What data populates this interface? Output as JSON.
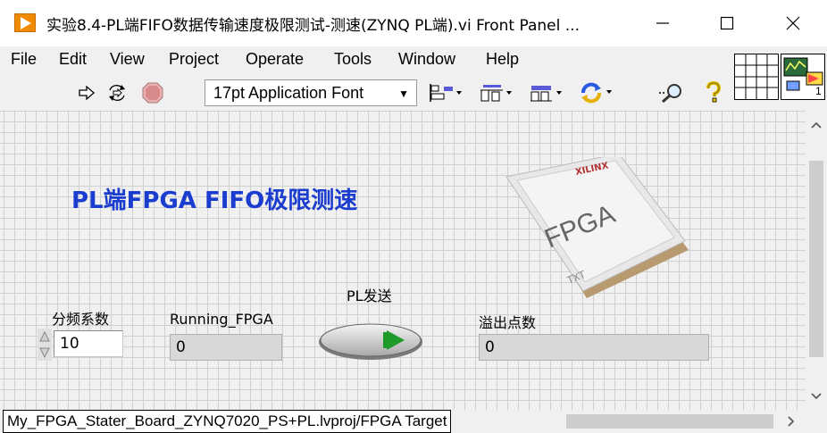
{
  "window": {
    "title": "实验8.4-PL端FIFO数据传输速度极限测试-测速(ZYNQ PL端).vi Front Panel ...",
    "min_glyph": "—",
    "max_glyph": "☐",
    "close_glyph": "✕"
  },
  "menu": {
    "items": [
      "File",
      "Edit",
      "View",
      "Project",
      "Operate",
      "Tools",
      "Window",
      "Help"
    ]
  },
  "toolbar": {
    "font_select": "17pt Application Font",
    "icons": [
      "run-arrow-icon",
      "run-continuous-icon",
      "abort-icon",
      "align-objects-icon",
      "distribute-objects-icon",
      "resize-objects-icon",
      "reorder-icon",
      "search-icon",
      "help-icon"
    ]
  },
  "vi_icon": {
    "number": "1"
  },
  "panel": {
    "heading": "PL端FPGA FIFO极限测速",
    "fpga_chip": {
      "brand": "XILINX",
      "text": "FPGA",
      "sub": "TXT"
    },
    "divider": {
      "label": "分频系数",
      "value": "10"
    },
    "running": {
      "label": "Running_FPGA",
      "value": "0"
    },
    "pl_send": {
      "label": "PL发送"
    },
    "overflow": {
      "label": "溢出点数",
      "value": "0"
    }
  },
  "status": {
    "path": "My_FPGA_Stater_Board_ZYNQ7020_PS+PL.lvproj/FPGA Target"
  },
  "colors": {
    "heading": "#1a3ccf",
    "button_led": "#1e9a2a",
    "app_icon": "#f08a00"
  }
}
